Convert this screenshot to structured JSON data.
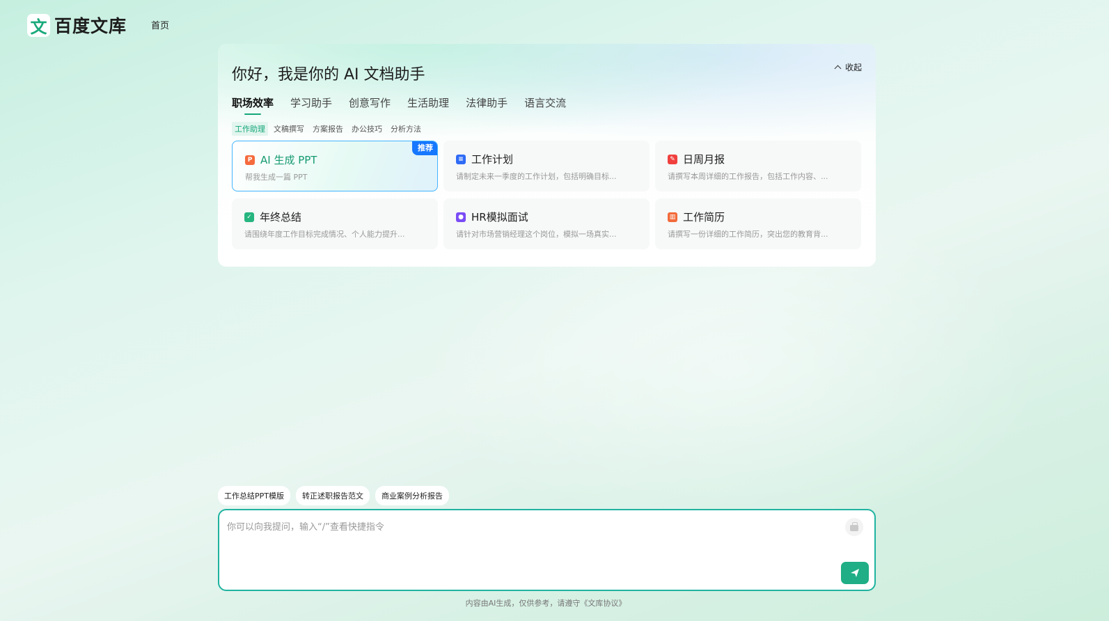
{
  "header": {
    "logo_glyph": "文",
    "logo_text": "百度文库",
    "nav_home": "首页"
  },
  "panel": {
    "title": "你好，我是你的 AI 文档助手",
    "collapse_label": "收起",
    "tabs": [
      {
        "label": "职场效率",
        "active": true
      },
      {
        "label": "学习助手"
      },
      {
        "label": "创意写作"
      },
      {
        "label": "生活助理"
      },
      {
        "label": "法律助手"
      },
      {
        "label": "语言交流"
      }
    ],
    "subtabs": [
      {
        "label": "工作助理",
        "active": true
      },
      {
        "label": "文稿撰写"
      },
      {
        "label": "方案报告"
      },
      {
        "label": "办公技巧"
      },
      {
        "label": "分析方法"
      }
    ],
    "cards": [
      {
        "title": "AI 生成 PPT",
        "desc": "帮我生成一篇 PPT",
        "icon": "ppt-icon",
        "icon_color": "#f56b3d",
        "badge": "推荐"
      },
      {
        "title": "工作计划",
        "desc": "请制定未来一季度的工作计划，包括明确目标...",
        "icon": "doc-icon",
        "icon_color": "#2f6bf5"
      },
      {
        "title": "日周月报",
        "desc": "请撰写本周详细的工作报告，包括工作内容、...",
        "icon": "pdf-icon",
        "icon_color": "#f0403e"
      },
      {
        "title": "年终总结",
        "desc": "请围绕年度工作目标完成情况、个人能力提升...",
        "icon": "check-icon",
        "icon_color": "#26b57f"
      },
      {
        "title": "HR模拟面试",
        "desc": "请针对市场营销经理这个岗位，模拟一场真实...",
        "icon": "person-icon",
        "icon_color": "#7a4cf5"
      },
      {
        "title": "工作简历",
        "desc": "请撰写一份详细的工作简历，突出您的教育背...",
        "icon": "resume-icon",
        "icon_color": "#f26a3a"
      }
    ]
  },
  "quick_prompts": [
    "工作总结PPT模版",
    "转正述职报告范文",
    "商业案例分析报告"
  ],
  "input": {
    "placeholder": "你可以向我提问，输入“/”查看快捷指令"
  },
  "footer": {
    "note": "内容由AI生成，仅供参考，请遵守《文库协议》"
  },
  "colors": {
    "accent": "#15a77a",
    "featured_border": "#42b4ff",
    "badge": "#1677ff"
  }
}
